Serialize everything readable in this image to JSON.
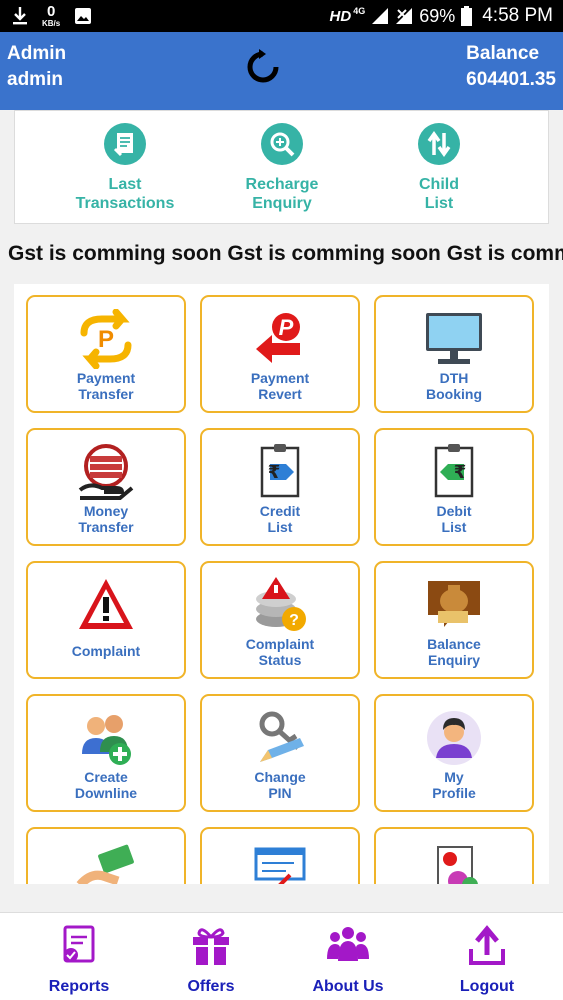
{
  "status_bar": {
    "speed_value": "0",
    "speed_unit": "KB/s",
    "network": "HD",
    "network_badge": "4G",
    "battery": "69%",
    "time": "4:58 PM"
  },
  "header": {
    "user_role": "Admin",
    "user_name": "admin",
    "balance_label": "Balance",
    "balance_value": "604401.35"
  },
  "quick_actions": [
    {
      "line1": "Last",
      "line2": "Transactions",
      "icon": "document-icon"
    },
    {
      "line1": "Recharge",
      "line2": "Enquiry",
      "icon": "magnifier-icon"
    },
    {
      "line1": "Child",
      "line2": "List",
      "icon": "transfer-arrows-icon"
    }
  ],
  "marquee_text": "Gst is comming soon Gst is comming soon Gst is comming soon",
  "tiles": [
    {
      "line1": "Payment",
      "line2": "Transfer",
      "icon": "payment-transfer-icon"
    },
    {
      "line1": "Payment",
      "line2": "Revert",
      "icon": "payment-revert-icon"
    },
    {
      "line1": "DTH",
      "line2": "Booking",
      "icon": "tv-monitor-icon"
    },
    {
      "line1": "Money",
      "line2": "Transfer",
      "icon": "money-transfer-icon"
    },
    {
      "line1": "Credit",
      "line2": "List",
      "icon": "credit-list-icon"
    },
    {
      "line1": "Debit",
      "line2": "List",
      "icon": "debit-list-icon"
    },
    {
      "line1": "Complaint",
      "line2": "",
      "icon": "warning-icon"
    },
    {
      "line1": "Complaint",
      "line2": "Status",
      "icon": "complaint-status-icon"
    },
    {
      "line1": "Balance",
      "line2": "Enquiry",
      "icon": "balance-enquiry-icon"
    },
    {
      "line1": "Create",
      "line2": "Downline",
      "icon": "create-downline-icon"
    },
    {
      "line1": "Change",
      "line2": "PIN",
      "icon": "change-pin-icon"
    },
    {
      "line1": "My",
      "line2": "Profile",
      "icon": "profile-avatar-icon"
    }
  ],
  "bottom_nav": [
    {
      "label": "Reports",
      "icon": "reports-icon"
    },
    {
      "label": "Offers",
      "icon": "gift-icon"
    },
    {
      "label": "About Us",
      "icon": "group-icon"
    },
    {
      "label": "Logout",
      "icon": "upload-icon"
    }
  ],
  "colors": {
    "header_blue": "#3a73cc",
    "quick_teal": "#36b3a6",
    "tile_border": "#f0b429",
    "tile_text": "#3a6fbe",
    "nav_icon_purple": "#a318c8",
    "nav_text": "#1a20b8"
  }
}
